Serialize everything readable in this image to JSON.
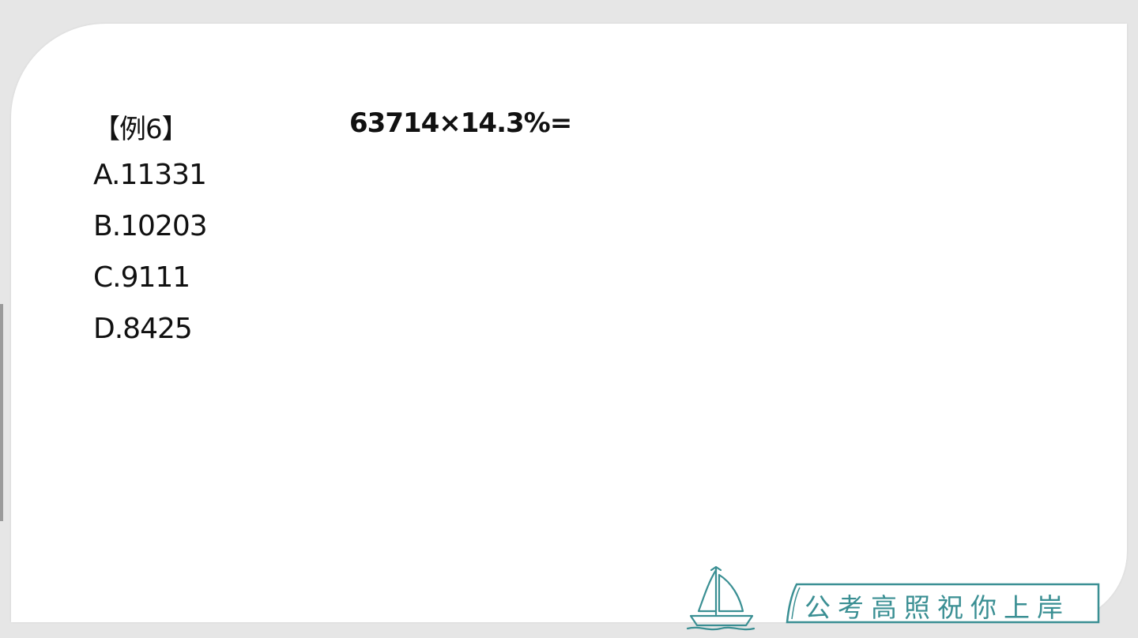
{
  "slide": {
    "example_tag": "【例6】",
    "equation": "63714×14.3%=",
    "options": [
      {
        "id": "A",
        "text": "A.11331"
      },
      {
        "id": "B",
        "text": "B.10203"
      },
      {
        "id": "C",
        "text": "C.9111"
      },
      {
        "id": "D",
        "text": "D.8425"
      }
    ]
  },
  "footer": {
    "slogan": "公考高照祝你上岸",
    "boat_icon": "sailboat-icon",
    "accent_color": "#3a8f93"
  }
}
